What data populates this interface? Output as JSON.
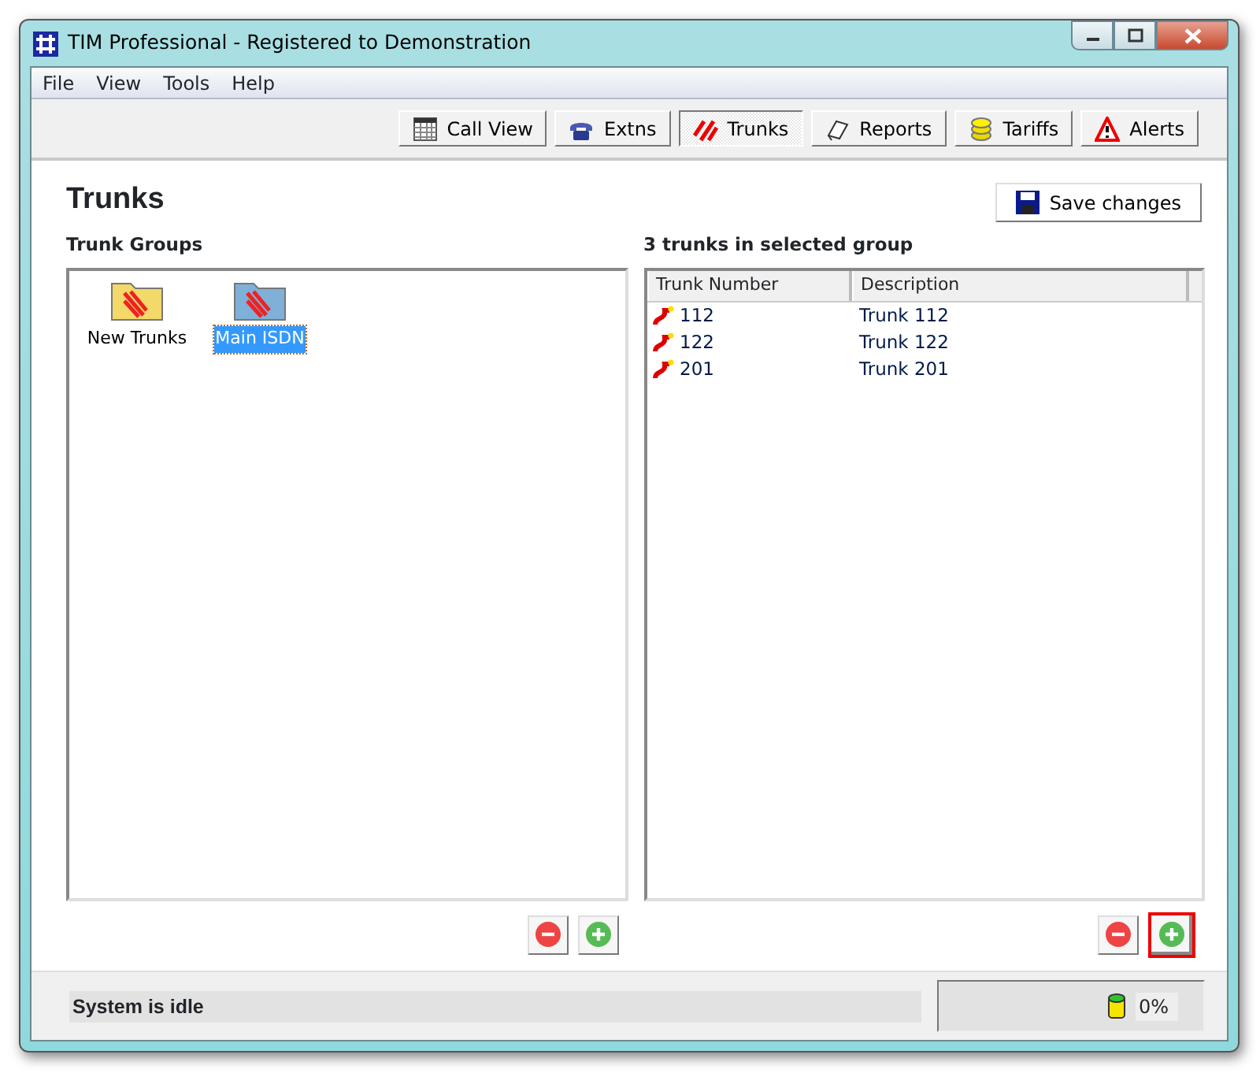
{
  "window": {
    "title": "TIM Professional - Registered to Demonstration"
  },
  "menu": [
    "File",
    "View",
    "Tools",
    "Help"
  ],
  "toolbar": [
    {
      "label": "Call View",
      "selected": false
    },
    {
      "label": "Extns",
      "selected": false
    },
    {
      "label": "Trunks",
      "selected": true
    },
    {
      "label": "Reports",
      "selected": false
    },
    {
      "label": "Tariffs",
      "selected": false
    },
    {
      "label": "Alerts",
      "selected": false
    }
  ],
  "page_title": "Trunks",
  "save_button": "Save changes",
  "groups": {
    "heading": "Trunk Groups",
    "items": [
      {
        "label": "New Trunks",
        "selected": false
      },
      {
        "label": "Main ISDN",
        "selected": true
      }
    ],
    "buttons": [
      {
        "kind": "remove",
        "highlighted": false
      },
      {
        "kind": "add",
        "highlighted": false
      }
    ]
  },
  "trunks": {
    "heading": "3 trunks in selected group",
    "columns": [
      "Trunk Number",
      "Description"
    ],
    "rows": [
      {
        "number": "112",
        "description": "Trunk 112"
      },
      {
        "number": "122",
        "description": "Trunk 122"
      },
      {
        "number": "201",
        "description": "Trunk 201"
      }
    ],
    "buttons": [
      {
        "kind": "remove",
        "highlighted": false
      },
      {
        "kind": "add",
        "highlighted": true
      }
    ]
  },
  "status_bar": {
    "message": "System is idle",
    "reading": "0%"
  }
}
